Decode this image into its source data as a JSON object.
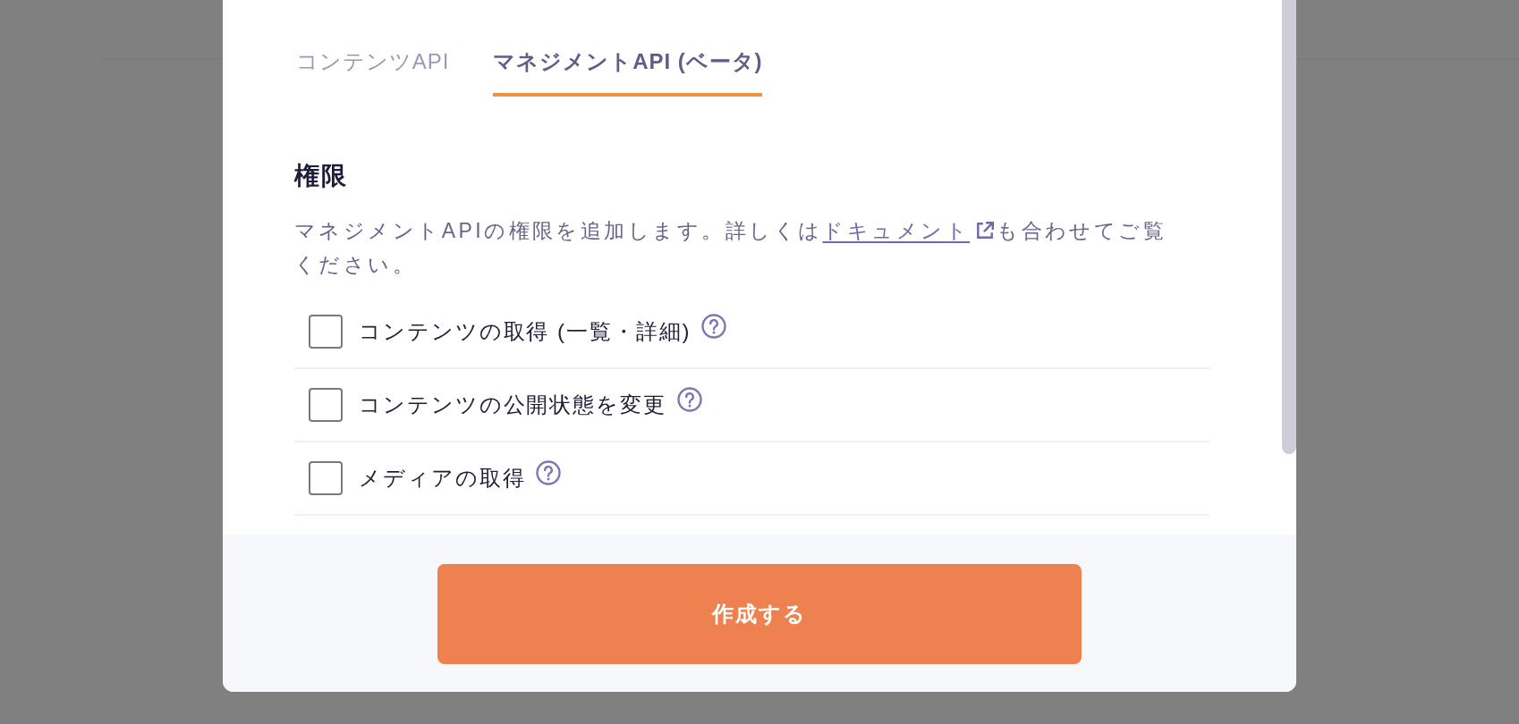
{
  "tabs": [
    {
      "label": "コンテンツAPI",
      "selected": false
    },
    {
      "label": "マネジメントAPI (ベータ)",
      "selected": true
    }
  ],
  "permissions": {
    "heading": "権限",
    "description": {
      "before": "マネジメントAPIの権限を追加します。詳しくは",
      "link": "ドキュメント",
      "after": "も合わせてご覧ください。"
    },
    "items": [
      {
        "label": "コンテンツの取得 (一覧・詳細)",
        "checked": false
      },
      {
        "label": "コンテンツの公開状態を変更",
        "checked": false
      },
      {
        "label": "メディアの取得",
        "checked": false
      }
    ]
  },
  "footer": {
    "button": "作成する"
  }
}
